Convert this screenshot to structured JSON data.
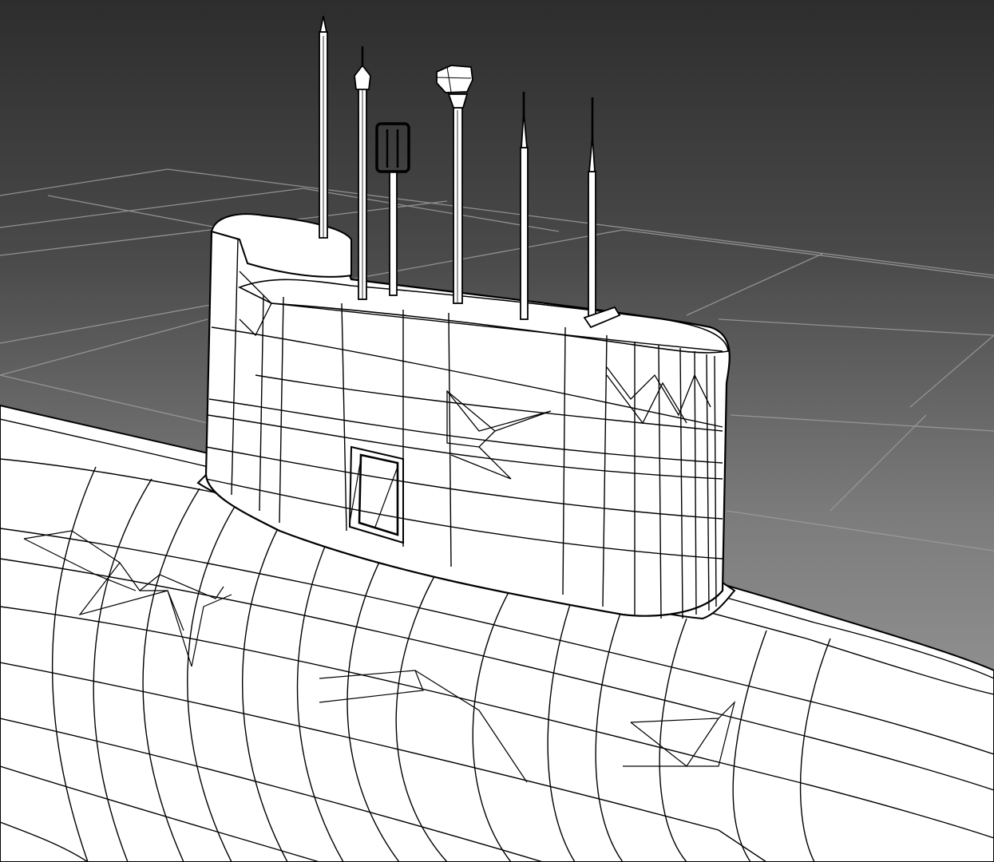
{
  "viewport": {
    "label": "",
    "background": [
      "#2d2d2d",
      "#a5a5a5"
    ],
    "wire_color": "#000000",
    "surface_color": "#ffffff",
    "grid_color": "#9a9a9a",
    "render_mode": "wireframe-on-shaded",
    "subject": "submarine-hull-with-sail-and-masts"
  }
}
